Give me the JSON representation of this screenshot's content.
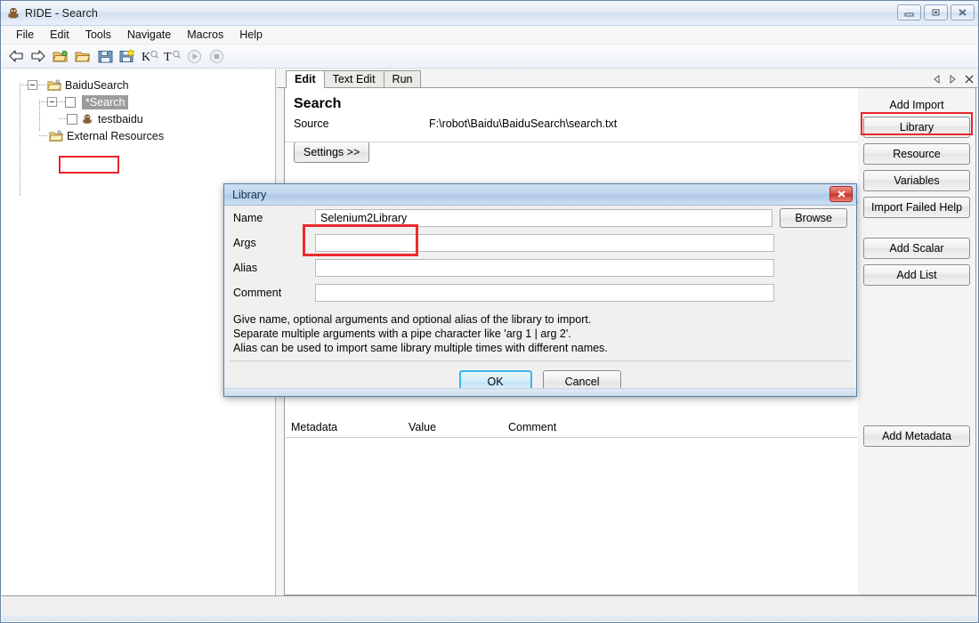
{
  "window": {
    "title": "RIDE - Search",
    "icon": "robot-icon",
    "minimize_label": "–",
    "restore_label": "❐",
    "close_label": "✕"
  },
  "menubar": {
    "items": [
      {
        "label": "File"
      },
      {
        "label": "Edit"
      },
      {
        "label": "Tools"
      },
      {
        "label": "Navigate"
      },
      {
        "label": "Macros"
      },
      {
        "label": "Help"
      }
    ]
  },
  "toolbar": {
    "items": [
      {
        "name": "back-arrow-icon"
      },
      {
        "name": "forward-arrow-icon"
      },
      {
        "name": "new-project-icon"
      },
      {
        "name": "open-folder-icon"
      },
      {
        "name": "save-icon"
      },
      {
        "name": "save-all-icon"
      },
      {
        "name": "search-keyword-icon",
        "label": "K"
      },
      {
        "name": "search-test-icon",
        "label": "T"
      },
      {
        "name": "run-icon"
      },
      {
        "name": "stop-icon"
      }
    ]
  },
  "tree": {
    "nodes": [
      {
        "label": "BaiduSearch",
        "icon": "suite-folder-icon",
        "selected": false
      },
      {
        "label": "*Search",
        "icon": "suite-folder-icon",
        "selected": true
      },
      {
        "label": "testbaidu",
        "icon": "robot-test-icon",
        "selected": false
      },
      {
        "label": "External Resources",
        "icon": "suite-folder-icon",
        "selected": false
      }
    ]
  },
  "tabs": {
    "items": [
      {
        "label": "Edit",
        "active": true
      },
      {
        "label": "Text Edit",
        "active": false
      },
      {
        "label": "Run",
        "active": false
      }
    ],
    "nav": {
      "prev_icon": "triangle-left-icon",
      "next_icon": "triangle-right-icon",
      "close_icon": "close-tab-icon"
    }
  },
  "editor": {
    "title": "Search",
    "source_label": "Source",
    "source_value": "F:\\robot\\Baidu\\BaiduSearch\\search.txt",
    "settings_button": "Settings >>"
  },
  "metadata_table": {
    "columns": [
      "Metadata",
      "Value",
      "Comment"
    ],
    "rows": []
  },
  "side_panel": {
    "add_import_label": "Add Import",
    "buttons": [
      {
        "label": "Library",
        "highlighted": true
      },
      {
        "label": "Resource",
        "highlighted": false
      },
      {
        "label": "Variables",
        "highlighted": false
      },
      {
        "label": "Import Failed Help",
        "highlighted": false
      }
    ],
    "variable_buttons": [
      {
        "label": "Add Scalar"
      },
      {
        "label": "Add List"
      }
    ],
    "add_metadata_button": "Add Metadata"
  },
  "dialog": {
    "title": "Library",
    "close_label": "✕",
    "fields": [
      {
        "label": "Name",
        "value": "Selenium2Library",
        "highlighted": true
      },
      {
        "label": "Args",
        "value": "",
        "highlighted": false
      },
      {
        "label": "Alias",
        "value": "",
        "highlighted": false
      },
      {
        "label": "Comment",
        "value": "",
        "highlighted": false
      }
    ],
    "browse_button": "Browse",
    "help_lines": [
      "Give name, optional arguments and optional alias of the library to import.",
      "Separate multiple arguments with a pipe character like 'arg 1 | arg 2'.",
      "Alias can be used to import same library multiple times with different names."
    ],
    "ok_button": "OK",
    "cancel_button": "Cancel"
  },
  "statusbar": {
    "text": ""
  },
  "colors": {
    "highlight_red": "#e8262b",
    "selection_gray": "#9c9c9c",
    "dialog_title": "#bfd4eb",
    "ok_border": "#39b6e8"
  }
}
